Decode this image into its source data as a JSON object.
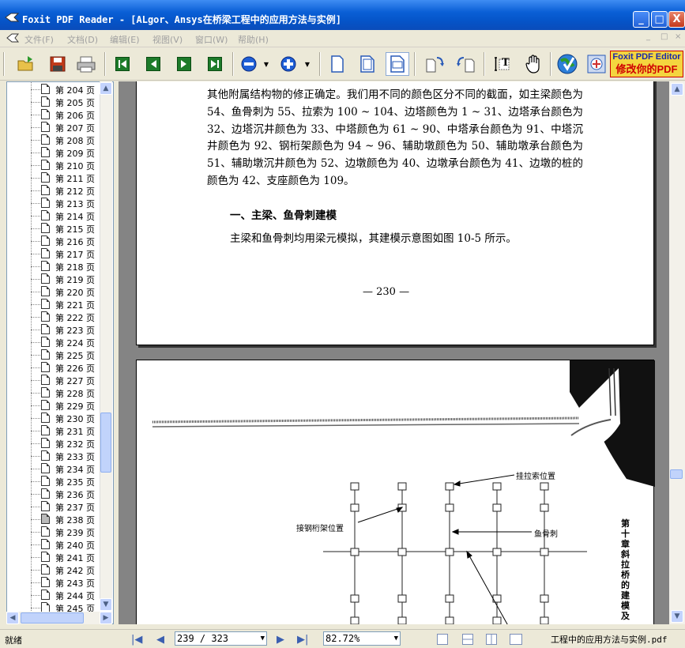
{
  "window": {
    "title": "Foxit PDF Reader - [ALgor、Ansys在桥梁工程中的应用方法与实例]",
    "minimize": "_",
    "maximize": "□",
    "close": "X"
  },
  "menu": {
    "items": [
      "文件(F)",
      "文档(D)",
      "编辑(E)",
      "视图(V)",
      "窗口(W)",
      "帮助(H)"
    ],
    "mdi_buttons": [
      "_",
      "□",
      "×"
    ]
  },
  "toolbar": {
    "ad_line1": "Foxit PDF Editor",
    "ad_line2": "修改你的PDF",
    "text_tool": "T"
  },
  "bookmarks": {
    "pages": [
      "第 204 页",
      "第 205 页",
      "第 206 页",
      "第 207 页",
      "第 208 页",
      "第 209 页",
      "第 210 页",
      "第 211 页",
      "第 212 页",
      "第 213 页",
      "第 214 页",
      "第 215 页",
      "第 216 页",
      "第 217 页",
      "第 218 页",
      "第 219 页",
      "第 220 页",
      "第 221 页",
      "第 222 页",
      "第 223 页",
      "第 224 页",
      "第 225 页",
      "第 226 页",
      "第 227 页",
      "第 228 页",
      "第 229 页",
      "第 230 页",
      "第 231 页",
      "第 232 页",
      "第 233 页",
      "第 234 页",
      "第 235 页",
      "第 236 页",
      "第 237 页",
      "第 238 页",
      "第 239 页",
      "第 240 页",
      "第 241 页",
      "第 242 页",
      "第 243 页",
      "第 244 页",
      "第 245 页"
    ],
    "selected": "第 238 页"
  },
  "document": {
    "paragraph1": "其他附属结构物的修正确定。我们用不同的颜色区分不同的截面，如主梁颜色为 54、鱼骨刺为 55、拉索为 100 ~ 104、边塔颜色为 1 ~ 31、边塔承台颜色为 32、边塔沉井颜色为 33、中塔颜色为 61 ~ 90、中塔承台颜色为 91、中塔沉井颜色为 92、钢桁架颜色为 94 ~ 96、辅助墩颜色为 50、辅助墩承台颜色为 51、辅助墩沉井颜色为 52、边墩颜色为 40、边墩承台颜色为 41、边墩的桩的颜色为 42、支座颜色为 109。",
    "heading": "一、主梁、鱼骨刺建模",
    "paragraph2": "主梁和鱼骨刺均用梁元模拟，其建模示意图如图 10-5 所示。",
    "page_number": "— 230 —",
    "figure_labels": {
      "cable": "挂拉索位置",
      "truss": "接钢桁架位置",
      "fishbone": "鱼骨刺"
    },
    "side_text": "第十章 斜拉桥的建模及"
  },
  "status": {
    "ready": "就绪",
    "page": "239 / 323",
    "zoom": "82.72%",
    "filename": "工程中的应用方法与实例.pdf"
  }
}
